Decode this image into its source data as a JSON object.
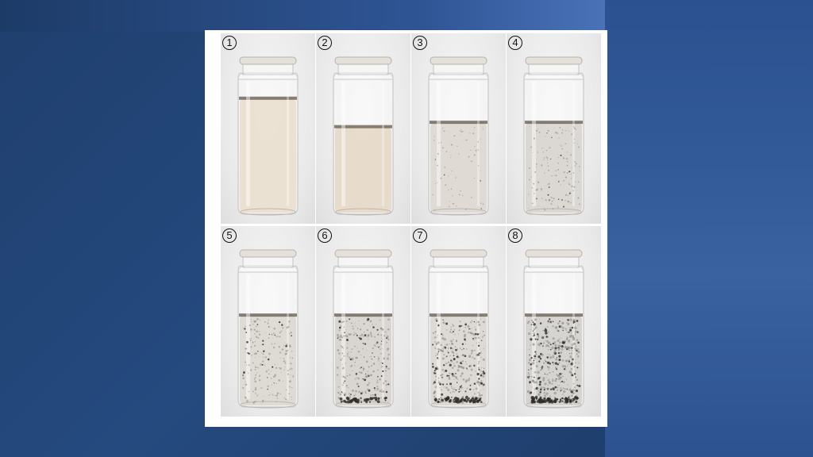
{
  "samples": [
    {
      "label": "1",
      "liquid": "#eadfce",
      "level": 0.53,
      "particles": 0
    },
    {
      "label": "2",
      "liquid": "#e6d8c7",
      "level": 0.4,
      "particles": 0
    },
    {
      "label": "3",
      "liquid": "#ddd8d0",
      "level": 0.42,
      "particles": 1
    },
    {
      "label": "4",
      "liquid": "#d8d4cf",
      "level": 0.42,
      "particles": 2
    },
    {
      "label": "5",
      "liquid": "#dcd8d2",
      "level": 0.42,
      "particles": 3
    },
    {
      "label": "6",
      "liquid": "#d6d2cc",
      "level": 0.42,
      "particles": 4
    },
    {
      "label": "7",
      "liquid": "#dad6d0",
      "level": 0.42,
      "particles": 5
    },
    {
      "label": "8",
      "liquid": "#d2d0cc",
      "level": 0.42,
      "particles": 6
    }
  ]
}
